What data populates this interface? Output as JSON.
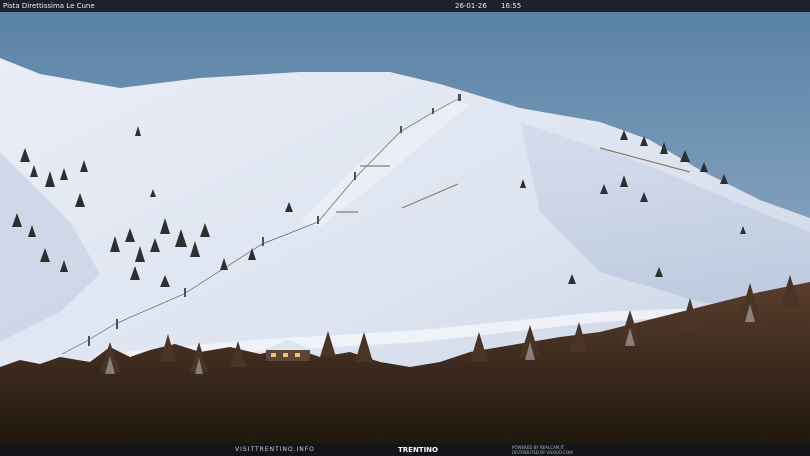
{
  "header": {
    "location_label": "Pista Direttissima Le Cune",
    "date": "26-01-26",
    "time": "16:55"
  },
  "footer": {
    "site": "VISITTRENTINO.INFO",
    "logo": "TRENTINO",
    "powered_line1": "POWERED BY REALCAM.IT",
    "powered_line2": "DISTRIBUTED BY VIEOUD.COM"
  },
  "scene_colors": {
    "sky_top": "#5f86a8",
    "sky_bottom": "#a9bfd3",
    "snow_light": "#e6ebf4",
    "snow_shadow": "#b9c6de",
    "forest": "#3b2a20"
  }
}
